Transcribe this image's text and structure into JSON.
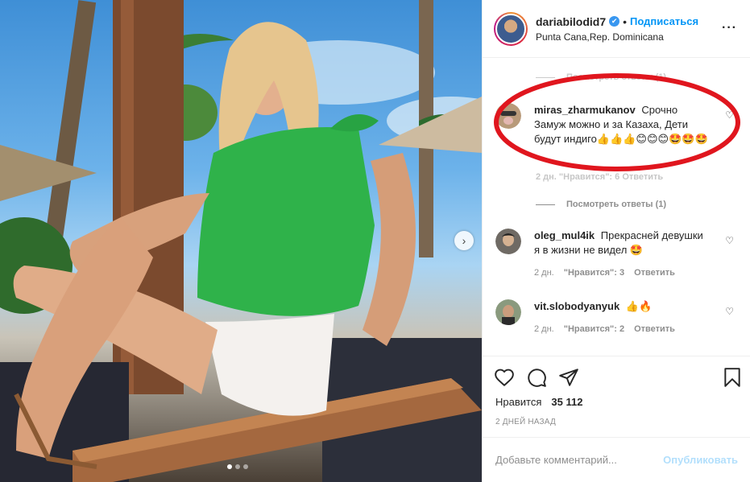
{
  "post": {
    "username": "dariabilodid7",
    "verified_mark": "✔",
    "separator": "•",
    "follow_label": "Подписаться",
    "location": "Punta Cana,Rep. Dominicana",
    "more_label": "···"
  },
  "photo": {
    "next_label": "›",
    "carousel_count": 3,
    "carousel_active": 1
  },
  "comments": {
    "partial_top": "Посмотреть ответы (1)",
    "view_replies_2": "Посмотреть ответы (1)",
    "hidden_meta": "2 дн.  \"Нравится\": 6  Ответить",
    "items": [
      {
        "user": "miras_zharmukanov",
        "text": "Срочно Замуж можно и за Казаха, Дети будут индиго👍👍👍😊😊😊🤩🤩🤩"
      },
      {
        "user": "oleg_mul4ik",
        "text": "Прекрасней девушки я в жизни не видел 🤩",
        "time": "2 дн.",
        "likes": "\"Нравится\": 3",
        "reply": "Ответить"
      },
      {
        "user": "vit.slobodyanyuk",
        "text": "👍🔥",
        "time": "2 дн.",
        "likes": "\"Нравится\": 2",
        "reply": "Ответить"
      }
    ]
  },
  "actions": {
    "likes_label": "Нравится",
    "likes_count": "35 112",
    "date": "2 ДНЕЙ НАЗАД"
  },
  "composer": {
    "placeholder": "Добавьте комментарий...",
    "publish_label": "Опубликовать"
  },
  "colors": {
    "accent": "#0095f6",
    "highlight_oval": "#e0161e",
    "publish_disabled": "#b2dffc"
  },
  "icons": [
    "heart-icon",
    "comment-icon",
    "share-icon",
    "bookmark-icon",
    "verified-icon",
    "more-icon",
    "chevron-right-icon"
  ]
}
